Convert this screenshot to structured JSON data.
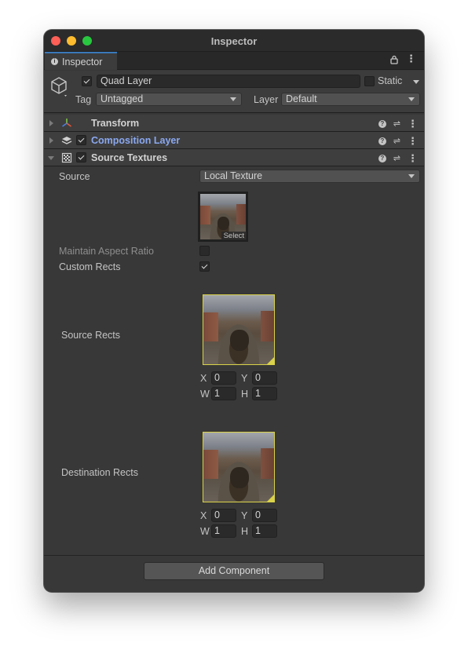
{
  "window": {
    "title": "Inspector"
  },
  "tab": {
    "label": "Inspector"
  },
  "object": {
    "name": "Quad Layer",
    "active": true,
    "static_label": "Static",
    "static": false,
    "tag_label": "Tag",
    "tag_value": "Untagged",
    "layer_label": "Layer",
    "layer_value": "Default"
  },
  "components": [
    {
      "name": "Transform",
      "icon": "transform-axes-icon",
      "enabled": null,
      "expanded": false
    },
    {
      "name": "Composition Layer",
      "icon": "layers-icon",
      "enabled": true,
      "expanded": false,
      "style": "link"
    },
    {
      "name": "Source Textures",
      "icon": "texture-grid-icon",
      "enabled": true,
      "expanded": true
    }
  ],
  "source_textures": {
    "source_label": "Source",
    "source_value": "Local Texture",
    "texture_select_label": "Select",
    "maintain_aspect_label": "Maintain Aspect Ratio",
    "maintain_aspect": false,
    "custom_rects_label": "Custom Rects",
    "custom_rects": true,
    "source_rects": {
      "label": "Source Rects",
      "x_label": "X",
      "x": "0",
      "y_label": "Y",
      "y": "0",
      "w_label": "W",
      "w": "1",
      "h_label": "H",
      "h": "1"
    },
    "destination_rects": {
      "label": "Destination Rects",
      "x_label": "X",
      "x": "0",
      "y_label": "Y",
      "y": "0",
      "w_label": "W",
      "w": "1",
      "h_label": "H",
      "h": "1"
    }
  },
  "add_component_label": "Add Component",
  "colors": {
    "accent": "#3a79bb",
    "link": "#8aa8f0",
    "rect_highlight": "#d9d24a"
  }
}
